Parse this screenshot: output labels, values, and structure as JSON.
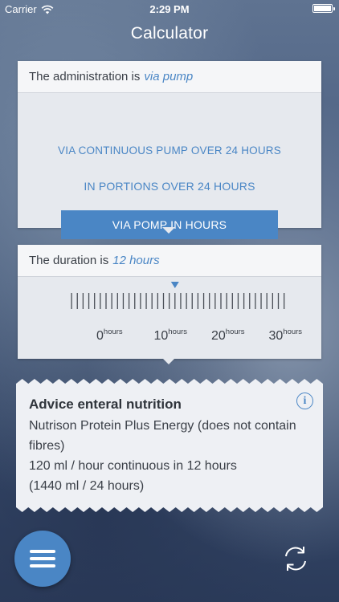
{
  "status_bar": {
    "carrier": "Carrier",
    "time": "2:29 PM"
  },
  "nav": {
    "title": "Calculator"
  },
  "administration": {
    "label": "The administration is",
    "value": "via pump",
    "options": [
      "VIA CONTINUOUS PUMP OVER 24 HOURS",
      "IN PORTIONS OVER 24 HOURS",
      "VIA POMP IN HOURS"
    ],
    "selected_index": 2
  },
  "duration": {
    "label": "The duration is",
    "value": "12 hours",
    "ruler": {
      "major_labels": [
        "0",
        "10",
        "20",
        "30"
      ],
      "unit": "hours",
      "selected_hours": 12
    }
  },
  "advice": {
    "title": "Advice enteral nutrition",
    "line1": "Nutrison Protein Plus Energy (does not contain fibres)",
    "line2": "120 ml / hour continuous in 12 hours",
    "line3": "(1440 ml / 24 hours)",
    "info_glyph": "i"
  },
  "icons": {
    "menu": "hamburger-menu-icon",
    "refresh": "refresh-icon",
    "info": "info-icon"
  },
  "colors": {
    "accent": "#4a86c5",
    "card": "#eef0f4"
  }
}
